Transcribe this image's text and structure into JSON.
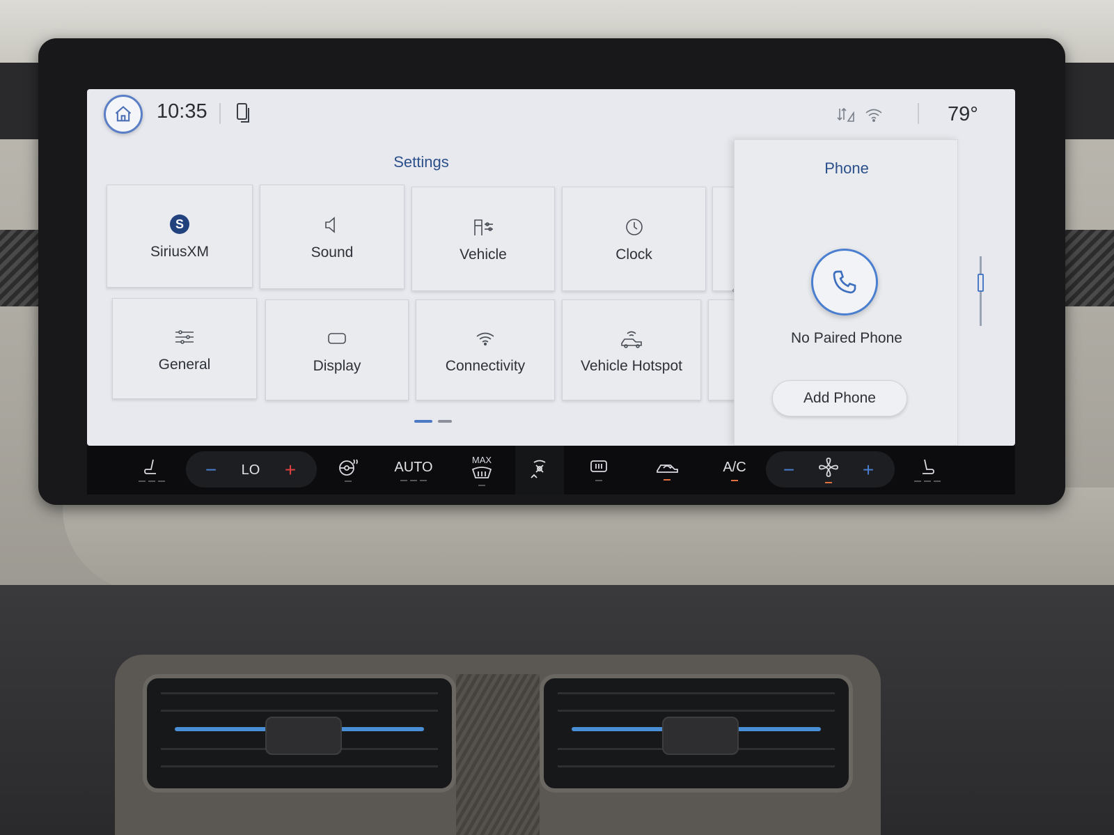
{
  "status_bar": {
    "time": "10:35",
    "temperature": "79°",
    "icons": [
      "home-icon",
      "phone-projection-icon",
      "data-signal-icon",
      "wifi-icon"
    ]
  },
  "settings": {
    "title": "Settings",
    "tiles": [
      {
        "label": "SiriusXM",
        "icon": "siriusxm-icon"
      },
      {
        "label": "Sound",
        "icon": "speaker-icon"
      },
      {
        "label": "Vehicle",
        "icon": "vehicle-settings-icon"
      },
      {
        "label": "Clock",
        "icon": "clock-icon"
      },
      {
        "label": "General",
        "icon": "sliders-icon"
      },
      {
        "label": "Display",
        "icon": "display-icon"
      },
      {
        "label": "Connectivity",
        "icon": "wifi-icon"
      },
      {
        "label": "Vehicle Hotspot",
        "icon": "hotspot-icon"
      }
    ]
  },
  "phone": {
    "title": "Phone",
    "status": "No Paired Phone",
    "add_button": "Add Phone"
  },
  "climate": {
    "driver_temp": "LO",
    "auto_label": "AUTO",
    "max_label": "MAX",
    "ac_label": "A/C",
    "minus": "−",
    "plus": "+"
  },
  "colors": {
    "accent_blue": "#2b4f8a",
    "ring_blue": "#4a7ed0",
    "climate_red": "#e04040",
    "indicator_orange": "#e07040"
  }
}
